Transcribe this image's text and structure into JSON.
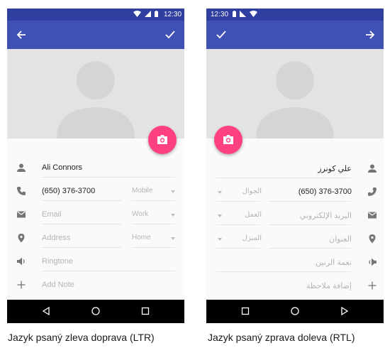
{
  "ltr": {
    "status_time": "12:30",
    "name_value": "Ali Connors",
    "phone_value": "(650) 376-3700",
    "phone_type": "Mobile",
    "email_placeholder": "Email",
    "email_type": "Work",
    "address_placeholder": "Address",
    "address_type": "Home",
    "ringtone_placeholder": "Ringtone",
    "note_placeholder": "Add Note"
  },
  "rtl": {
    "status_time": "12:30",
    "name_value": "علي كونرز",
    "phone_value": "(650) 376-3700",
    "phone_type": "الجوال",
    "email_placeholder": "البريد الإلكتروني",
    "email_type": "العمل",
    "address_placeholder": "العنوان",
    "address_type": "المنزل",
    "ringtone_placeholder": "نغمة الرنين",
    "note_placeholder": "إضافة ملاحظة"
  },
  "captions": {
    "ltr": "Jazyk psaný zleva doprava (LTR)",
    "rtl": "Jazyk psaný zprava doleva (RTL)"
  },
  "colors": {
    "appbar": "#3f51b5",
    "statusbar": "#303f9f",
    "fab": "#ff4081"
  },
  "icons": {
    "back": "arrow-left-icon",
    "confirm": "check-icon",
    "photo": "camera-icon",
    "name": "person-icon",
    "phone": "phone-icon",
    "email": "email-icon",
    "address": "location-pin-icon",
    "ringtone": "speaker-icon",
    "note": "plus-icon"
  }
}
